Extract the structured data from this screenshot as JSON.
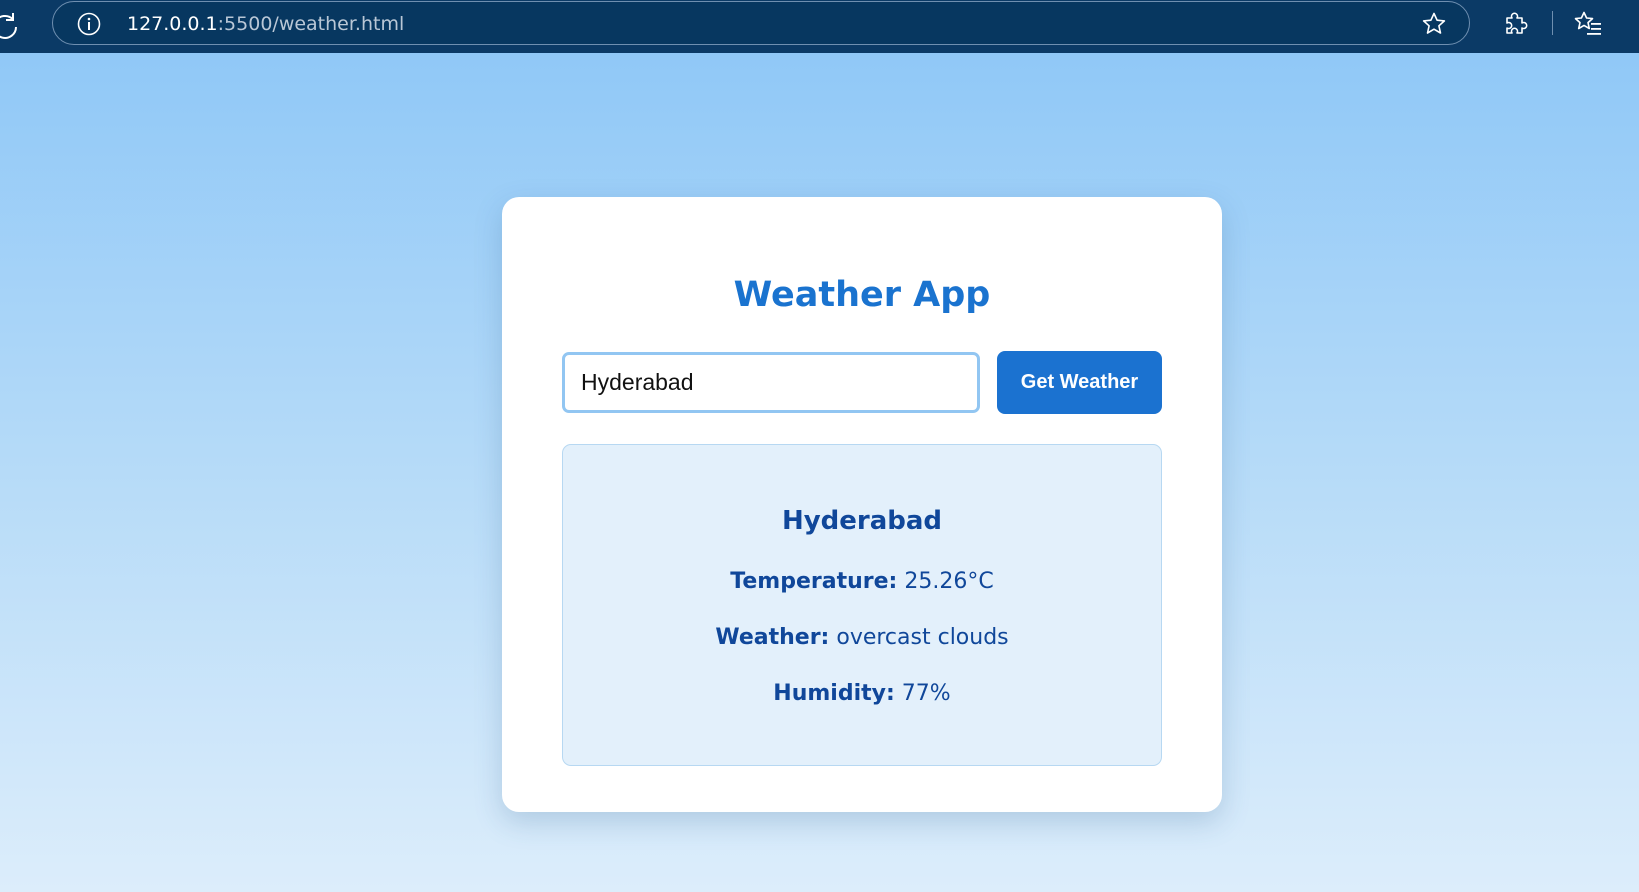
{
  "browser": {
    "url_host": "127.0.0.1",
    "url_path": ":5500/weather.html"
  },
  "app": {
    "title": "Weather App",
    "search": {
      "value": "Hyderabad",
      "button_label": "Get Weather"
    },
    "result": {
      "city": "Hyderabad",
      "temperature_label": "Temperature:",
      "temperature_value": "25.26°C",
      "weather_label": "Weather:",
      "weather_value": "overcast clouds",
      "humidity_label": "Humidity:",
      "humidity_value": "77%"
    }
  },
  "colors": {
    "browser_bar": "#0b3a66",
    "accent": "#1b72d0",
    "result_text": "#10479a"
  }
}
